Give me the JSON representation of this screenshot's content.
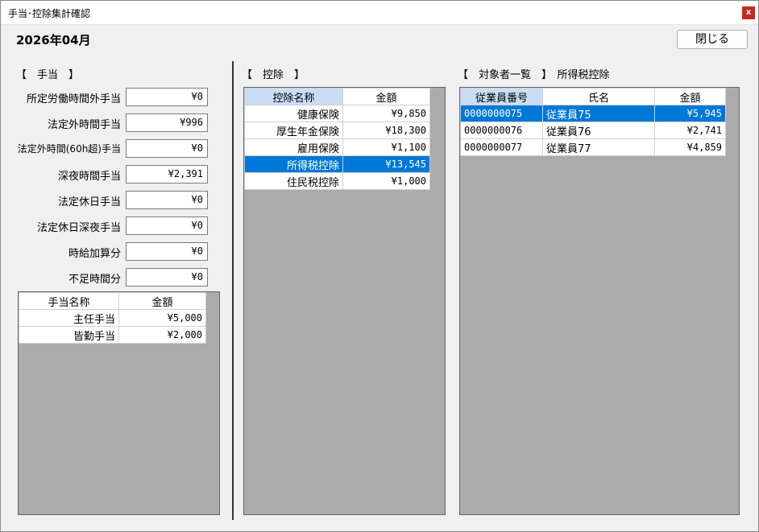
{
  "window": {
    "title": "手当･控除集計確認",
    "close_glyph": "x"
  },
  "header": {
    "period": "2026年04月",
    "close_button": "閉じる"
  },
  "allowance": {
    "section_label": "【　手当　】",
    "fields": [
      {
        "label": "所定労働時間外手当",
        "value": "¥0"
      },
      {
        "label": "法定外時間手当",
        "value": "¥996"
      },
      {
        "label": "法定外時間(60h超)手当",
        "value": "¥0"
      },
      {
        "label": "深夜時間手当",
        "value": "¥2,391"
      },
      {
        "label": "法定休日手当",
        "value": "¥0"
      },
      {
        "label": "法定休日深夜手当",
        "value": "¥0"
      },
      {
        "label": "時給加算分",
        "value": "¥0"
      },
      {
        "label": "不足時間分",
        "value": "¥0"
      }
    ],
    "table": {
      "headers": [
        "手当名称",
        "金額"
      ],
      "rows": [
        {
          "name": "主任手当",
          "amount": "¥5,000"
        },
        {
          "name": "皆勤手当",
          "amount": "¥2,000"
        }
      ]
    }
  },
  "deduction": {
    "section_label": "【　控除　】",
    "table": {
      "headers": [
        "控除名称",
        "金額"
      ],
      "rows": [
        {
          "name": "健康保険",
          "amount": "¥9,850"
        },
        {
          "name": "厚生年金保険",
          "amount": "¥18,300"
        },
        {
          "name": "雇用保険",
          "amount": "¥1,100"
        },
        {
          "name": "所得税控除",
          "amount": "¥13,545"
        },
        {
          "name": "住民税控除",
          "amount": "¥1,000"
        }
      ]
    }
  },
  "targets": {
    "section_label": "【　対象者一覧　】　所得税控除",
    "table": {
      "headers": [
        "従業員番号",
        "氏名",
        "金額"
      ],
      "rows": [
        {
          "id": "0000000075",
          "name": "従業員75",
          "amount": "¥5,945"
        },
        {
          "id": "0000000076",
          "name": "従業員76",
          "amount": "¥2,741"
        },
        {
          "id": "0000000077",
          "name": "従業員77",
          "amount": "¥4,859"
        }
      ]
    }
  },
  "colors": {
    "selection": "#0078d7",
    "header_highlight": "#c9def5",
    "grid_background": "#ababab",
    "close_button": "#c42b1c"
  }
}
